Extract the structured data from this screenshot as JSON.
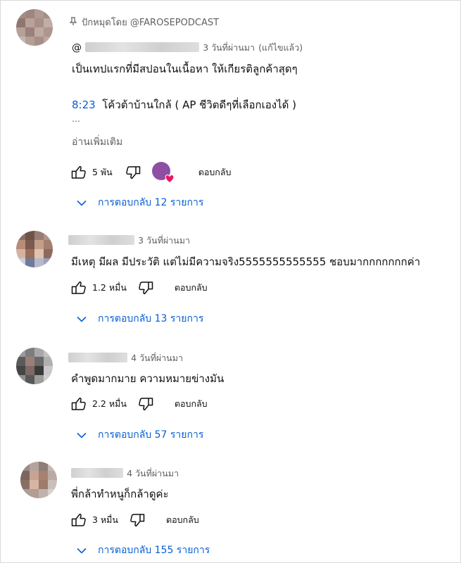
{
  "comments": [
    {
      "pinned_label": "ปักหมุดโดย @FAROSEPODCAST",
      "handle_prefix": "@",
      "time": "3 วันที่ผ่านมา",
      "edited": "(แก้ไขแล้ว)",
      "line1": "เป็นเทปแรกที่มีสปอนในเนื้อหา ให้เกียรติลูกค้าสุดๆ",
      "timestamp_link": "8:23",
      "line2": "โค้วต้าบ้านใกล้ ( AP ชีวิตดีๆที่เลือกเองได้ )",
      "ellipsis": "...",
      "read_more": "อ่านเพิ่มเติม",
      "likes": "5 พัน",
      "reply_label": "ตอบกลับ",
      "replies_label": "การตอบกลับ 12 รายการ",
      "hearted": true
    },
    {
      "time": "3 วันที่ผ่านมา",
      "text": "มีเหตุ มีผล มีประวัติ แต่ไม่มีความจริง5555555555555 ชอบมากกกกกกกค่า",
      "likes": "1.2 หมื่น",
      "reply_label": "ตอบกลับ",
      "replies_label": "การตอบกลับ 13 รายการ"
    },
    {
      "time": "4 วันที่ผ่านมา",
      "text": "คำพูดมากมาย ความหมายข่างมัน",
      "likes": "2.2 หมื่น",
      "reply_label": "ตอบกลับ",
      "replies_label": "การตอบกลับ 57 รายการ"
    },
    {
      "time": "4 วันที่ผ่านมา",
      "text": "พี่กล้าทำหนูก็กล้าดูค่ะ",
      "likes": "3 หมื่น",
      "reply_label": "ตอบกลับ",
      "replies_label": "การตอบกลับ 155 รายการ"
    }
  ],
  "colors": {
    "link": "#065fd4",
    "muted": "#606060",
    "text": "#0f0f0f",
    "heart": "#e5195f",
    "creator_avatar": "#8e4fa3"
  },
  "icons": [
    "pin-icon",
    "like-icon",
    "dislike-icon",
    "heart-icon",
    "chevron-down-icon"
  ]
}
